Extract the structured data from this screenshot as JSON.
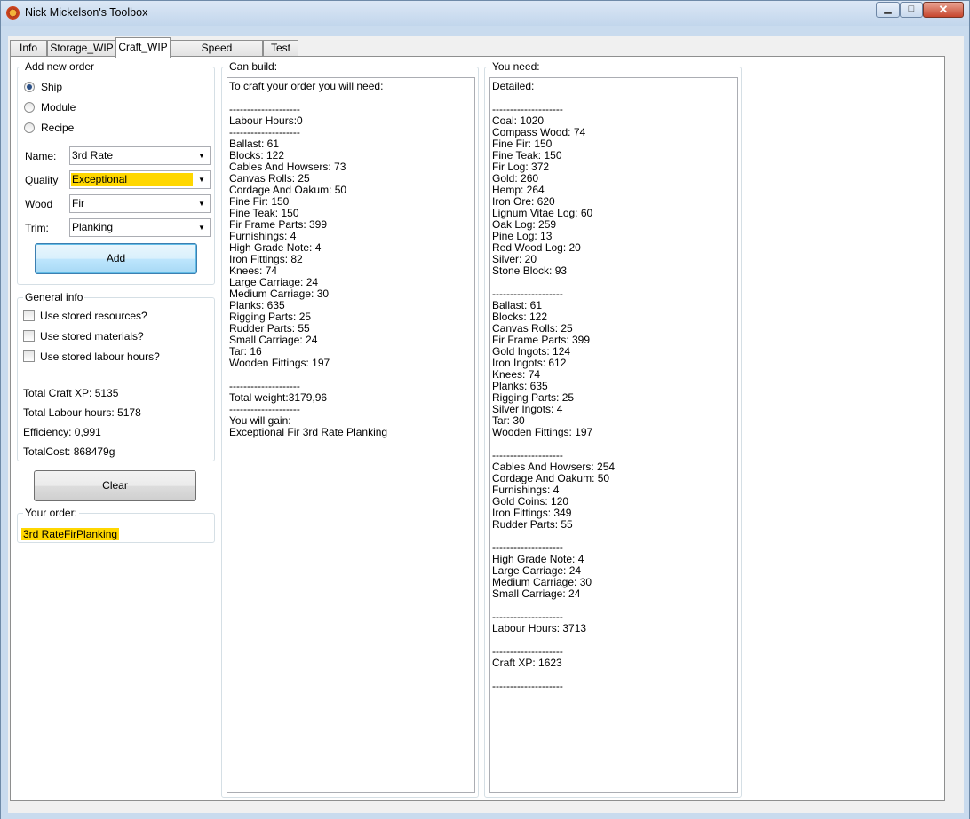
{
  "window": {
    "title": "Nick Mickelson's Toolbox",
    "min_glyph": "▁",
    "max_glyph": "□",
    "close_glyph": "✕"
  },
  "tabs": [
    "Info",
    "Storage_WIP",
    "Craft_WIP",
    "Speed Curves_WIP",
    "Test"
  ],
  "active_tab": "Craft_WIP",
  "new_order": {
    "title": "Add new order",
    "types": [
      "Ship",
      "Module",
      "Recipe"
    ],
    "selected_type": "Ship",
    "fields": [
      {
        "label": "Name:",
        "value": "3rd Rate",
        "highlight": false
      },
      {
        "label": "Quality",
        "value": "Exceptional",
        "highlight": true
      },
      {
        "label": "Wood",
        "value": "Fir",
        "highlight": false
      },
      {
        "label": "Trim:",
        "value": "Planking",
        "highlight": false
      }
    ],
    "add_label": "Add"
  },
  "general_info": {
    "title": "General info",
    "options": [
      "Use stored resources?",
      "Use stored materials?",
      "Use stored labour hours?"
    ],
    "stats": [
      "Total Craft XP:  5135",
      "Total Labour hours:  5178",
      "Efficiency:  0,991",
      "TotalCost:  868479g"
    ]
  },
  "clear_label": "Clear",
  "your_order": {
    "title": "Your order:",
    "value": "3rd RateFirPlanking"
  },
  "can_build": {
    "title": "Can build:",
    "lines": [
      "To craft your order you will need:",
      "",
      "--------------------",
      "Labour Hours:0",
      "--------------------",
      "Ballast:  61",
      "Blocks:  122",
      "Cables And Howsers:  73",
      "Canvas Rolls:  25",
      "Cordage And Oakum:  50",
      "Fine Fir:  150",
      "Fine Teak:  150",
      "Fir Frame Parts:  399",
      "Furnishings:  4",
      "High Grade Note:  4",
      "Iron Fittings:  82",
      "Knees:  74",
      "Large Carriage:  24",
      "Medium Carriage:  30",
      "Planks:  635",
      "Rigging Parts:  25",
      "Rudder Parts:  55",
      "Small Carriage:  24",
      "Tar:  16",
      "Wooden Fittings:  197",
      "",
      "--------------------",
      "Total weight:3179,96",
      "--------------------",
      "You will gain:",
      "Exceptional Fir 3rd Rate Planking"
    ]
  },
  "you_need": {
    "title": "You need:",
    "lines": [
      "Detailed:",
      "",
      "--------------------",
      "Coal:  1020",
      "Compass Wood:  74",
      "Fine Fir:  150",
      "Fine Teak:  150",
      "Fir Log:  372",
      "Gold:  260",
      "Hemp:  264",
      "Iron Ore:  620",
      "Lignum Vitae Log:  60",
      "Oak Log:  259",
      "Pine Log:  13",
      "Red Wood Log:  20",
      "Silver:  20",
      "Stone Block:  93",
      "",
      "--------------------",
      "Ballast:  61",
      "Blocks:  122",
      "Canvas Rolls:  25",
      "Fir Frame Parts:  399",
      "Gold Ingots:  124",
      "Iron Ingots:  612",
      "Knees:  74",
      "Planks:  635",
      "Rigging Parts:  25",
      "Silver Ingots:  4",
      "Tar:  30",
      "Wooden Fittings:  197",
      "",
      "--------------------",
      "Cables And Howsers:  254",
      "Cordage And Oakum:  50",
      "Furnishings:  4",
      "Gold Coins:  120",
      "Iron Fittings:  349",
      "Rudder Parts:  55",
      "",
      "--------------------",
      "High Grade Note:  4",
      "Large Carriage:  24",
      "Medium Carriage:  30",
      "Small Carriage:  24",
      "",
      "--------------------",
      "Labour Hours:  3713",
      "",
      "--------------------",
      "Craft XP:  1623",
      "",
      "--------------------"
    ]
  }
}
